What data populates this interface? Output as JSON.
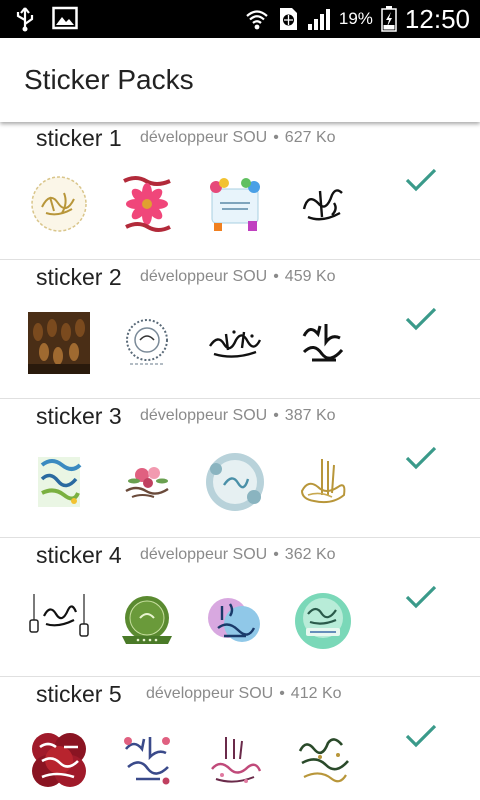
{
  "status_bar": {
    "battery_percent": "19%",
    "time": "12:50",
    "icons": [
      "usb-icon",
      "image-icon",
      "wifi-icon",
      "data-saver-icon",
      "signal-icon",
      "battery-charging-icon"
    ]
  },
  "app_bar": {
    "title": "Sticker Packs"
  },
  "accent_color": "#3a9a8a",
  "packs": [
    {
      "name": "sticker 1",
      "publisher": "développeur SOU",
      "separator": "•",
      "size": "627 Ko"
    },
    {
      "name": "sticker 2",
      "publisher": "développeur SOU",
      "separator": "•",
      "size": "459 Ko"
    },
    {
      "name": "sticker 3",
      "publisher": "développeur SOU",
      "separator": "•",
      "size": "387 Ko"
    },
    {
      "name": "sticker 4",
      "publisher": "développeur SOU",
      "separator": "•",
      "size": "362 Ko"
    },
    {
      "name": "sticker 5",
      "publisher": "développeur SOU",
      "separator": "•",
      "size": "412 Ko"
    }
  ]
}
